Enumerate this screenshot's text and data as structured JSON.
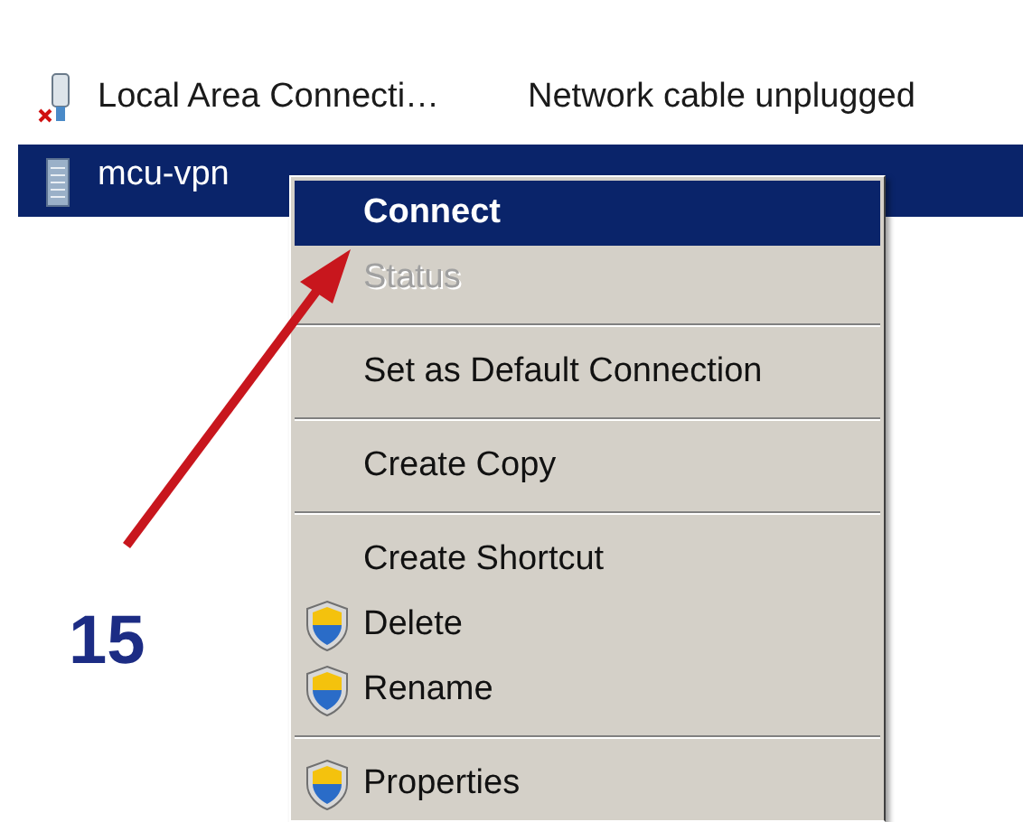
{
  "connections": [
    {
      "kind": "lan-unplugged",
      "name": "Local Area Connecti…",
      "status": "Network cable unplugged",
      "selected": false
    },
    {
      "kind": "vpn",
      "name": "mcu-vpn",
      "selected": true
    }
  ],
  "context_menu": {
    "items": [
      {
        "kind": "item",
        "label": "Connect",
        "default": true,
        "selected": true,
        "disabled": false,
        "shield": false
      },
      {
        "kind": "item",
        "label": "Status",
        "default": false,
        "selected": false,
        "disabled": true,
        "shield": false
      },
      {
        "kind": "separator"
      },
      {
        "kind": "item",
        "label": "Set as Default Connection",
        "default": false,
        "selected": false,
        "disabled": false,
        "shield": false
      },
      {
        "kind": "separator"
      },
      {
        "kind": "item",
        "label": "Create Copy",
        "default": false,
        "selected": false,
        "disabled": false,
        "shield": false
      },
      {
        "kind": "separator"
      },
      {
        "kind": "item",
        "label": "Create Shortcut",
        "default": false,
        "selected": false,
        "disabled": false,
        "shield": false
      },
      {
        "kind": "item",
        "label": "Delete",
        "default": false,
        "selected": false,
        "disabled": false,
        "shield": true
      },
      {
        "kind": "item",
        "label": "Rename",
        "default": false,
        "selected": false,
        "disabled": false,
        "shield": true
      },
      {
        "kind": "separator"
      },
      {
        "kind": "item",
        "label": "Properties",
        "default": false,
        "selected": false,
        "disabled": false,
        "shield": true
      }
    ]
  },
  "annotation": {
    "step": "15"
  }
}
